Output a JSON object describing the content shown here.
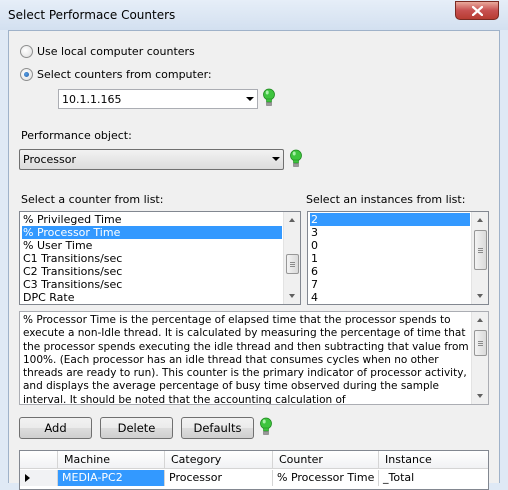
{
  "window": {
    "title": "Select Performace Counters"
  },
  "source": {
    "local_label": "Use local computer counters",
    "remote_label": "Select counters from computer:",
    "computer_value": "10.1.1.165"
  },
  "perf_object": {
    "label": "Performance object:",
    "value": "Processor"
  },
  "counters": {
    "label": "Select a counter from list:",
    "items": [
      "% Privileged Time",
      "% Processor Time",
      "% User Time",
      "C1 Transitions/sec",
      "C2 Transitions/sec",
      "C3 Transitions/sec",
      "DPC Rate"
    ],
    "selected": "% Processor Time"
  },
  "instances": {
    "label": "Select an instances from list:",
    "items": [
      "2",
      "3",
      "0",
      "1",
      "6",
      "7",
      "4"
    ],
    "selected": "2"
  },
  "description": "% Processor Time is the percentage of elapsed time that the processor spends to execute a non-Idle thread. It is calculated by measuring the percentage of time that the processor spends executing the idle thread and then subtracting that value from 100%. (Each processor has an idle thread that consumes cycles when no other threads are ready to run). This counter is the primary indicator of processor activity, and displays the average percentage of busy time observed during the sample interval. It should be noted that the accounting calculation of",
  "buttons": {
    "add": "Add",
    "delete": "Delete",
    "defaults": "Defaults"
  },
  "grid": {
    "headers": [
      "Machine",
      "Category",
      "Counter",
      "Instance"
    ],
    "rows": [
      {
        "machine": "MEDIA-PC2",
        "category": "Processor",
        "counter": "% Processor Time",
        "instance": "_Total"
      }
    ]
  },
  "colors": {
    "selection": "#3399ff",
    "bulb": "#3ec43e"
  },
  "icons": {
    "close": "close-icon",
    "status": "green-lightbulb-icon"
  }
}
